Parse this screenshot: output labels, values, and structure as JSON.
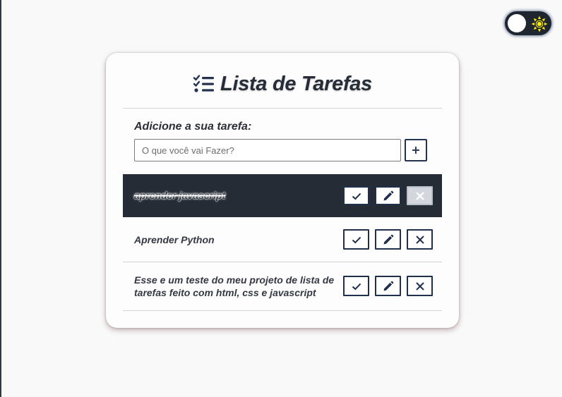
{
  "app": {
    "title": "Lista de Tarefas",
    "title_icon": "list-check-icon",
    "theme_toggle": {
      "state": "light",
      "icon": "sun-icon"
    }
  },
  "add_task": {
    "label": "Adicione a sua tarefa:",
    "placeholder": "O que você vai Fazer?",
    "value": "",
    "button_label": "+"
  },
  "tasks": [
    {
      "text": "aprender javascript",
      "done": true
    },
    {
      "text": "Aprender Python",
      "done": false
    },
    {
      "text": "Esse e um teste do meu projeto de lista de tarefas feito com html, css e javascript",
      "done": false
    }
  ],
  "task_actions": [
    "check-icon",
    "pencil-icon",
    "close-icon"
  ],
  "colors": {
    "accent": "#1f2f4c",
    "done_row_bg": "#252c36",
    "page_bg": "#f9f9f9",
    "sun": "#ffee00"
  }
}
